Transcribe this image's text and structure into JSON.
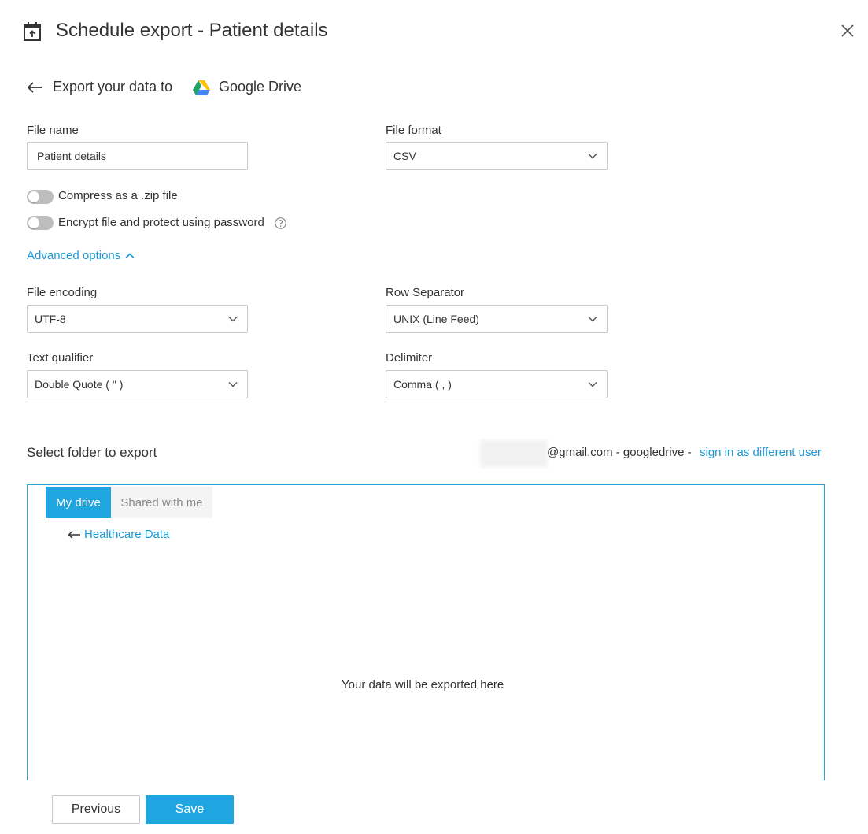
{
  "header": {
    "title": "Schedule export - Patient details",
    "icon": "calendar-export-icon"
  },
  "destination": {
    "label": "Export your data to",
    "service_name": "Google Drive"
  },
  "form": {
    "file_name_label": "File name",
    "file_name_value": "Patient details",
    "file_format_label": "File format",
    "file_format_value": "CSV",
    "compress_label": "Compress as a .zip file",
    "compress_on": false,
    "encrypt_label": "Encrypt file and protect using password",
    "encrypt_on": false,
    "advanced_label": "Advanced options",
    "file_encoding_label": "File encoding",
    "file_encoding_value": "UTF-8",
    "row_separator_label": "Row Separator",
    "row_separator_value": "UNIX (Line Feed)",
    "text_qualifier_label": "Text qualifier",
    "text_qualifier_value": "Double Quote ( \" )",
    "delimiter_label": "Delimiter",
    "delimiter_value": "Comma ( , )"
  },
  "folder": {
    "section_label": "Select folder to export",
    "account_text": "@gmail.com - googledrive  -",
    "sign_in_link": "sign in as different user",
    "tabs": [
      {
        "label": "My drive",
        "active": true
      },
      {
        "label": "Shared with me",
        "active": false
      }
    ],
    "breadcrumb": "Healthcare Data",
    "empty_message": "Your data will be exported here"
  },
  "footer": {
    "previous_label": "Previous",
    "save_label": "Save"
  },
  "colors": {
    "accent": "#1fa6e0",
    "link": "#1a9ad7",
    "panel_border": "#2aa4d6",
    "toggle_off": "#bdbdbd"
  }
}
